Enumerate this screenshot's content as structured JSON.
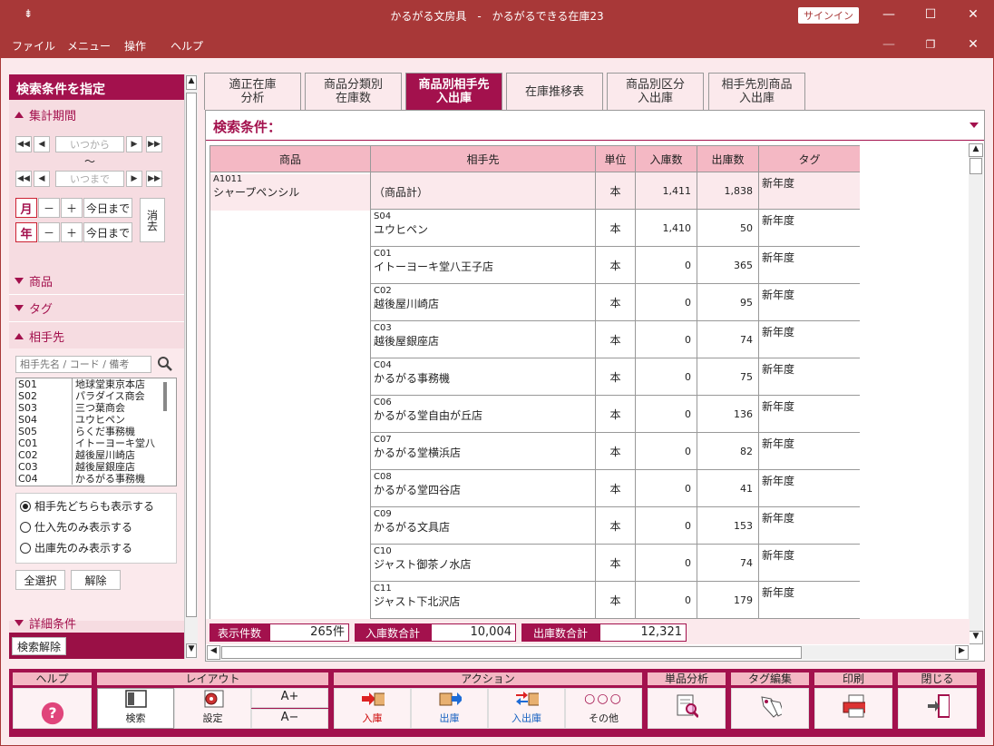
{
  "window": {
    "title": "かるがる文房具　-　かるがるできる在庫23",
    "signin": "サインイン"
  },
  "menu": [
    "ファイル",
    "メニュー",
    "操作",
    "ヘルプ"
  ],
  "left_panel": {
    "header": "検索条件を指定",
    "period_label": "集計期間",
    "from_placeholder": "いつから",
    "tilde": "～",
    "to_placeholder": "いつまで",
    "month_label": "月",
    "year_label": "年",
    "minus": "－",
    "plus": "＋",
    "until_today": "今日まで",
    "clear": "消去",
    "product_label": "商品",
    "tag_label": "タグ",
    "partner_label": "相手先",
    "partner_search_placeholder": "相手先名 / コード / 備考",
    "partners": [
      {
        "code": "S01",
        "name": "地球堂東京本店"
      },
      {
        "code": "S02",
        "name": "パラダイス商会"
      },
      {
        "code": "S03",
        "name": "三つ葉商会"
      },
      {
        "code": "S04",
        "name": "ユウヒペン"
      },
      {
        "code": "S05",
        "name": "らくだ事務機"
      },
      {
        "code": "C01",
        "name": "イトーヨーキ堂八"
      },
      {
        "code": "C02",
        "name": "越後屋川崎店"
      },
      {
        "code": "C03",
        "name": "越後屋銀座店"
      },
      {
        "code": "C04",
        "name": "かるがる事務機"
      }
    ],
    "radio_options": [
      "相手先どちらも表示する",
      "仕入先のみ表示する",
      "出庫先のみ表示する"
    ],
    "select_all": "全選択",
    "deselect": "解除",
    "detail_label": "詳細条件",
    "search_clear": "検索解除"
  },
  "tabs": [
    {
      "l1": "適正在庫",
      "l2": "分析"
    },
    {
      "l1": "商品分類別",
      "l2": "在庫数"
    },
    {
      "l1": "商品別相手先",
      "l2": "入出庫"
    },
    {
      "l1": "在庫推移表",
      "l2": ""
    },
    {
      "l1": "商品別区分",
      "l2": "入出庫"
    },
    {
      "l1": "相手先別商品",
      "l2": "入出庫"
    }
  ],
  "main": {
    "condition_label": "検索条件："
  },
  "table": {
    "headers": [
      "商品",
      "相手先",
      "単位",
      "入庫数",
      "出庫数",
      "タグ"
    ],
    "product_code": "A1011",
    "product_name": "シャープペンシル",
    "rows": [
      {
        "code": "",
        "partner": "（商品計）",
        "unit": "本",
        "in": "1,411",
        "out": "1,838",
        "tag": "新年度"
      },
      {
        "code": "S04",
        "partner": "ユウヒペン",
        "unit": "本",
        "in": "1,410",
        "out": "50",
        "tag": "新年度"
      },
      {
        "code": "C01",
        "partner": "イトーヨーキ堂八王子店",
        "unit": "本",
        "in": "0",
        "out": "365",
        "tag": "新年度"
      },
      {
        "code": "C02",
        "partner": "越後屋川崎店",
        "unit": "本",
        "in": "0",
        "out": "95",
        "tag": "新年度"
      },
      {
        "code": "C03",
        "partner": "越後屋銀座店",
        "unit": "本",
        "in": "0",
        "out": "74",
        "tag": "新年度"
      },
      {
        "code": "C04",
        "partner": "かるがる事務機",
        "unit": "本",
        "in": "0",
        "out": "75",
        "tag": "新年度"
      },
      {
        "code": "C06",
        "partner": "かるがる堂自由が丘店",
        "unit": "本",
        "in": "0",
        "out": "136",
        "tag": "新年度"
      },
      {
        "code": "C07",
        "partner": "かるがる堂横浜店",
        "unit": "本",
        "in": "0",
        "out": "82",
        "tag": "新年度"
      },
      {
        "code": "C08",
        "partner": "かるがる堂四谷店",
        "unit": "本",
        "in": "0",
        "out": "41",
        "tag": "新年度"
      },
      {
        "code": "C09",
        "partner": "かるがる文具店",
        "unit": "本",
        "in": "0",
        "out": "153",
        "tag": "新年度"
      },
      {
        "code": "C10",
        "partner": "ジャスト御茶ノ水店",
        "unit": "本",
        "in": "0",
        "out": "74",
        "tag": "新年度"
      },
      {
        "code": "C11",
        "partner": "ジャスト下北沢店",
        "unit": "本",
        "in": "0",
        "out": "179",
        "tag": "新年度"
      }
    ]
  },
  "footer": {
    "count_label": "表示件数",
    "count_value": "265件",
    "in_total_label": "入庫数合計",
    "in_total_value": "10,004",
    "out_total_label": "出庫数合計",
    "out_total_value": "12,321"
  },
  "toolbar": {
    "help_group": "ヘルプ",
    "layout_group": "レイアウト",
    "action_group": "アクション",
    "item_analysis_group": "単品分析",
    "tag_edit_group": "タグ編集",
    "print_group": "印刷",
    "close_group": "閉じる",
    "search": "検索",
    "settings": "設定",
    "font_up": "A+",
    "font_down": "A−",
    "stock_in": "入庫",
    "stock_out": "出庫",
    "stock_inout": "入出庫",
    "other": "その他"
  },
  "colors": {
    "title_bar": "#a83838",
    "accent": "#a3114d",
    "header_pink": "#f4b8c4",
    "bg_pink": "#fbe9ec"
  }
}
